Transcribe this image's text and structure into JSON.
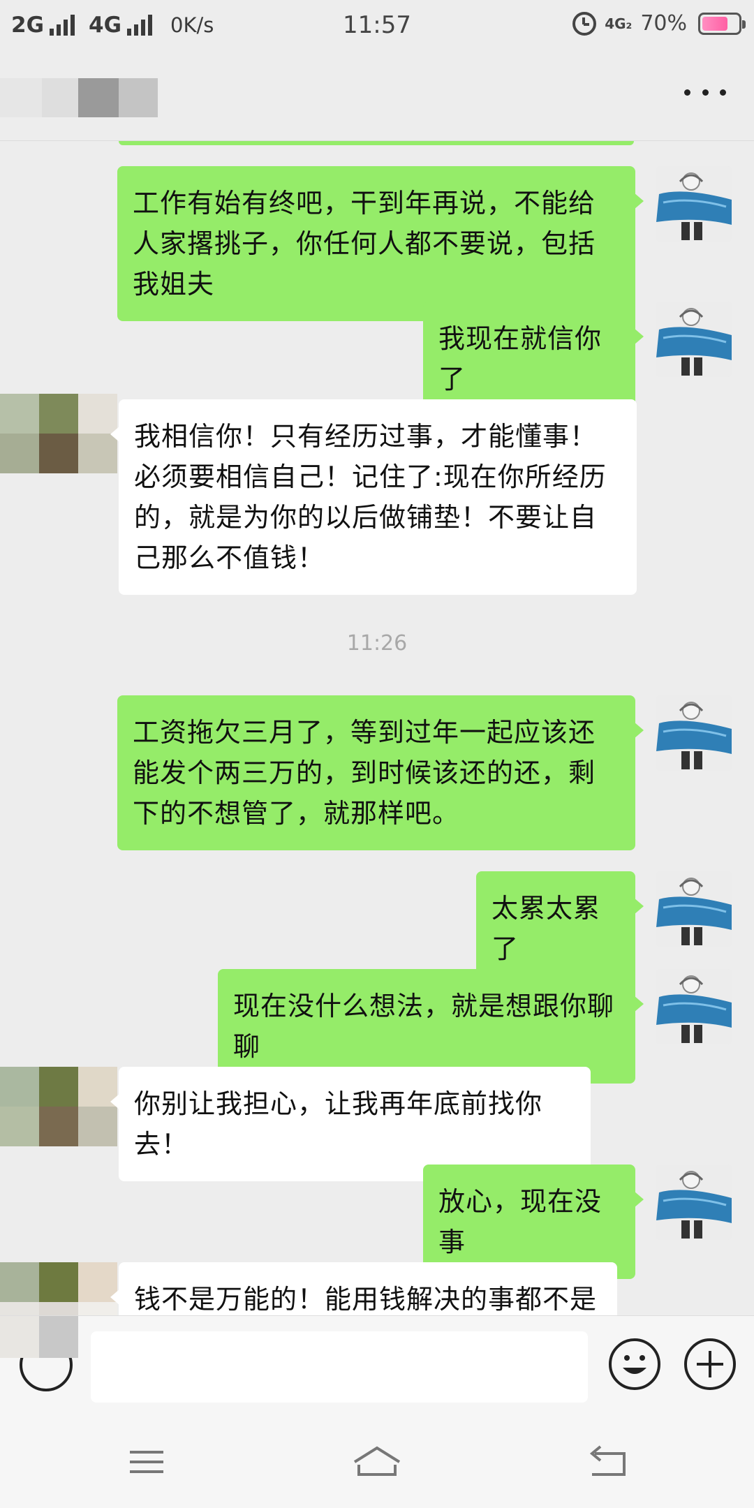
{
  "status_bar": {
    "net1": "2G",
    "net2": "4G",
    "speed": "0K/s",
    "time": "11:57",
    "net_4g": "4G₂",
    "battery": "70%",
    "battery_level": 0.7
  },
  "nav": {
    "more_icon": "more-dots-icon"
  },
  "messages": [
    {
      "side": "out",
      "text": "工作有始有终吧，干到年再说，不能给人家撂挑子，你任何人都不要说，包括我姐夫"
    },
    {
      "side": "out",
      "text": "我现在就信你了"
    },
    {
      "side": "in",
      "text": "我相信你！只有经历过事，才能懂事！必须要相信自己！记住了:现在你所经历的，就是为你的以后做铺垫！不要让自己那么不值钱！"
    },
    {
      "side": "time",
      "text": "11:26"
    },
    {
      "side": "out",
      "text": "工资拖欠三月了，等到过年一起应该还能发个两三万的，到时候该还的还，剩下的不想管了，就那样吧。"
    },
    {
      "side": "out",
      "text": "太累太累了"
    },
    {
      "side": "out",
      "text": "现在没什么想法，就是想跟你聊聊"
    },
    {
      "side": "in",
      "text": "你别让我担心，让我再年底前找你去！"
    },
    {
      "side": "out",
      "text": "放心，现在没事"
    },
    {
      "side": "in",
      "text": "钱不是万能的！能用钱解决的事都不是事"
    }
  ],
  "input_bar": {
    "value": "",
    "emoji_icon": "emoji-smile-icon",
    "plus_icon": "plus-circle-icon",
    "voice_icon": "voice-icon"
  },
  "colors": {
    "out_bubble": "#95ec69",
    "in_bubble": "#ffffff",
    "background": "#ededed"
  }
}
